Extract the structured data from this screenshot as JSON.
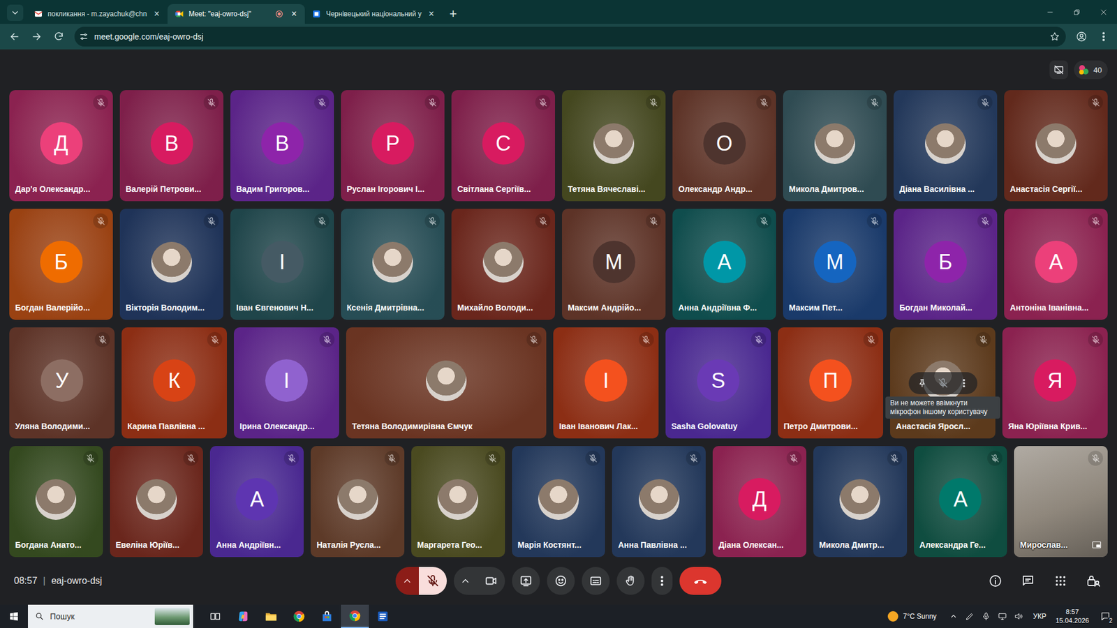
{
  "browser": {
    "tabs": [
      {
        "label": "покликання - m.zayachuk@chn",
        "close": "×",
        "selected": false,
        "recording": false
      },
      {
        "label": "Meet: \"eaj-owro-dsj\"",
        "close": "×",
        "selected": true,
        "recording": true
      },
      {
        "label": "Чернівецький національний у",
        "close": "×",
        "selected": false,
        "recording": false
      }
    ],
    "new_tab": "+",
    "url": "meet.google.com/eaj-owro-dsj"
  },
  "meeting": {
    "participant_count": "40",
    "time": "08:57",
    "separator": "|",
    "code": "eaj-owro-dsj"
  },
  "grid": {
    "rows": [
      {
        "tiles": [
          {
            "name": "Дар'я Олександр...",
            "kind": "letter",
            "initial": "Д",
            "color": "#8b2250",
            "avatar_color": "#ec407a",
            "muted": true,
            "hovered": false
          },
          {
            "name": "Валерій Петрови...",
            "kind": "letter",
            "initial": "В",
            "color": "#7e1f4a",
            "avatar_color": "#d81b60",
            "muted": true,
            "hovered": false
          },
          {
            "name": "Вадим Григоров...",
            "kind": "letter",
            "initial": "В",
            "color": "#5b2488",
            "avatar_color": "#8e24aa",
            "muted": true,
            "hovered": false
          },
          {
            "name": "Руслан Ігорович І...",
            "kind": "letter",
            "initial": "Р",
            "color": "#7e1f4a",
            "avatar_color": "#d81b60",
            "muted": true,
            "hovered": false
          },
          {
            "name": "Світлана Сергіїв...",
            "kind": "letter",
            "initial": "С",
            "color": "#7e1f4a",
            "avatar_color": "#d81b60",
            "muted": true,
            "hovered": false
          },
          {
            "name": "Тетяна Вячеславі...",
            "kind": "photo",
            "color": "#44471f",
            "muted": true,
            "hovered": false
          },
          {
            "name": "Олександр Андр...",
            "kind": "letter",
            "initial": "О",
            "color": "#5d3327",
            "avatar_color": "#4e342e",
            "muted": true,
            "hovered": false
          },
          {
            "name": "Микола Дмитров...",
            "kind": "photo",
            "color": "#2f4b52",
            "muted": true,
            "hovered": false
          },
          {
            "name": "Діана Василівна ...",
            "kind": "photo",
            "color": "#23385a",
            "muted": true,
            "hovered": false
          },
          {
            "name": "Анастасія Сергії...",
            "kind": "photo",
            "color": "#62291c",
            "muted": true,
            "hovered": false
          }
        ]
      },
      {
        "tiles": [
          {
            "name": "Богдан Валерійо...",
            "kind": "letter",
            "initial": "Б",
            "color": "#9a4212",
            "avatar_color": "#ef6c00",
            "muted": true,
            "hovered": false
          },
          {
            "name": "Вікторія Володим...",
            "kind": "photo",
            "color": "#1f3358",
            "muted": true,
            "hovered": false
          },
          {
            "name": "Іван Євгенович Н...",
            "kind": "letter",
            "initial": "І",
            "color": "#1f454a",
            "avatar_color": "#455a64",
            "muted": true,
            "hovered": false
          },
          {
            "name": "Ксенія Дмитрівна...",
            "kind": "photo",
            "color": "#274d55",
            "muted": true,
            "hovered": false
          },
          {
            "name": "Михайло Володи...",
            "kind": "photo",
            "color": "#6a261c",
            "muted": true,
            "hovered": false
          },
          {
            "name": "Максим Андрійо...",
            "kind": "letter",
            "initial": "М",
            "color": "#5d3327",
            "avatar_color": "#4e342e",
            "muted": true,
            "hovered": false
          },
          {
            "name": "Анна Андріївна Ф...",
            "kind": "letter",
            "initial": "А",
            "color": "#0f4d4d",
            "avatar_color": "#0097a7",
            "muted": true,
            "hovered": false
          },
          {
            "name": "Максим Пет...",
            "kind": "letter",
            "initial": "М",
            "color": "#1a3a6a",
            "avatar_color": "#1565c0",
            "muted": true,
            "hovered": false
          },
          {
            "name": "Богдан Миколай...",
            "kind": "letter",
            "initial": "Б",
            "color": "#5b2488",
            "avatar_color": "#8e24aa",
            "muted": true,
            "hovered": false
          },
          {
            "name": "Антоніна Іванівна...",
            "kind": "letter",
            "initial": "А",
            "color": "#8b2250",
            "avatar_color": "#ec407a",
            "muted": true,
            "hovered": false
          }
        ]
      },
      {
        "tiles": [
          {
            "name": "Уляна Володими...",
            "kind": "letter",
            "initial": "У",
            "color": "#5d3327",
            "avatar_color": "#8d6e63",
            "muted": true,
            "hovered": false
          },
          {
            "name": "Карина Павлівна ...",
            "kind": "letter",
            "initial": "К",
            "color": "#8c2e14",
            "avatar_color": "#d84315",
            "muted": true,
            "hovered": false
          },
          {
            "name": "Ірина Олександр...",
            "kind": "letter",
            "initial": "І",
            "color": "#5b2488",
            "avatar_color": "#9062cf",
            "muted": true,
            "hovered": false
          },
          {
            "name": "Тетяна Володимирівна Ємчук",
            "kind": "wide",
            "color": "#6a3422",
            "muted": true,
            "hovered": false
          },
          {
            "name": "Іван Іванович Лак...",
            "kind": "letter",
            "initial": "І",
            "color": "#8c2e14",
            "avatar_color": "#f4511e",
            "muted": true,
            "hovered": false
          },
          {
            "name": "Sasha Golovatuy",
            "kind": "letter",
            "initial": "S",
            "color": "#4a2890",
            "avatar_color": "#6a3ab5",
            "muted": true,
            "hovered": false
          },
          {
            "name": "Петро Дмитрови...",
            "kind": "letter",
            "initial": "П",
            "color": "#8c2e14",
            "avatar_color": "#f4511e",
            "muted": true,
            "hovered": false
          },
          {
            "name": "Анастасія Яросл...",
            "kind": "photo",
            "color": "#5c3a1c",
            "muted": true,
            "hovered": true,
            "tooltip": "Ви не можете ввімкнути мікрофон іншому користувачу"
          },
          {
            "name": "Яна Юріївна Крив...",
            "kind": "letter",
            "initial": "Я",
            "color": "#8b2250",
            "avatar_color": "#d81b60",
            "muted": true,
            "hovered": false
          }
        ]
      },
      {
        "tiles": [
          {
            "name": "Богдана Анато...",
            "kind": "photo",
            "color": "#34491f",
            "muted": true,
            "hovered": false
          },
          {
            "name": "Евеліна Юріїв...",
            "kind": "photo",
            "color": "#6a261c",
            "muted": true,
            "hovered": false
          },
          {
            "name": "Анна Андріївн...",
            "kind": "letter",
            "initial": "А",
            "color": "#4a2890",
            "avatar_color": "#5e35b1",
            "muted": true,
            "hovered": false
          },
          {
            "name": "Наталія Русла...",
            "kind": "photo",
            "color": "#5d3a28",
            "muted": true,
            "hovered": false
          },
          {
            "name": "Маргарета Гео...",
            "kind": "photo",
            "color": "#4a4a20",
            "muted": true,
            "hovered": false
          },
          {
            "name": "Марія Костянт...",
            "kind": "photo",
            "color": "#23385a",
            "muted": true,
            "hovered": false
          },
          {
            "name": "Анна Павлівна ...",
            "kind": "photo",
            "color": "#23385a",
            "muted": true,
            "hovered": false
          },
          {
            "name": "Діана Олексан...",
            "kind": "letter",
            "initial": "Д",
            "color": "#8b2250",
            "avatar_color": "#d81b60",
            "muted": true,
            "hovered": false
          },
          {
            "name": "Микола Дмитр...",
            "kind": "photo",
            "color": "#23385a",
            "muted": true,
            "hovered": false
          },
          {
            "name": "Александра Ге...",
            "kind": "letter",
            "initial": "А",
            "color": "#0f4d40",
            "avatar_color": "#00796b",
            "muted": true,
            "hovered": false
          },
          {
            "name": "Мирослав...",
            "kind": "video",
            "color": "#8f877c",
            "muted": true,
            "hovered": false
          }
        ]
      }
    ]
  },
  "toolbar": {
    "mic_muted": true
  },
  "taskbar": {
    "search_placeholder": "Пошук",
    "weather": "7°C  Sunny",
    "language": "УКР",
    "time": "8:57",
    "date": "15.04.2026",
    "notifications": "2"
  }
}
